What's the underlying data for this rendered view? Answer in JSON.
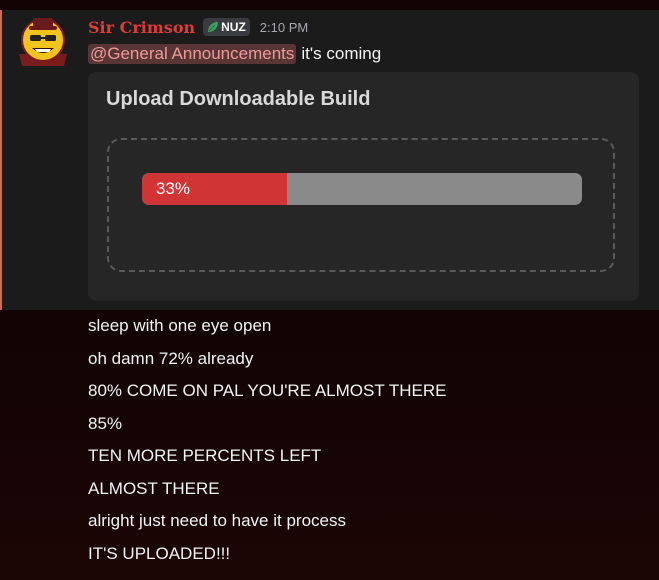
{
  "message": {
    "username": "Sir Crimson",
    "tag": {
      "label": "NUZ",
      "icon": "leaf-icon",
      "color": "#3ba55d"
    },
    "timestamp": "2:10 PM",
    "mention": "@General Announcements",
    "text": "it's coming"
  },
  "embed": {
    "title": "Upload Downloadable Build",
    "progress": {
      "label": "33%",
      "fraction": 0.33
    }
  },
  "followups": [
    "sleep with one eye open",
    "oh damn 72% already",
    "80% COME ON PAL YOU'RE ALMOST THERE",
    "85%",
    "TEN MORE PERCENTS LEFT",
    "ALMOST THERE",
    "alright just need to have it process",
    "IT'S UPLOADED!!!"
  ],
  "colors": {
    "username": "#e03b3b",
    "mention_bg": "#5a3535",
    "mention_text": "#ef9a9a",
    "progress_fill": "#d13434",
    "progress_track": "#8a8a8a",
    "embed_bg": "#262626"
  }
}
